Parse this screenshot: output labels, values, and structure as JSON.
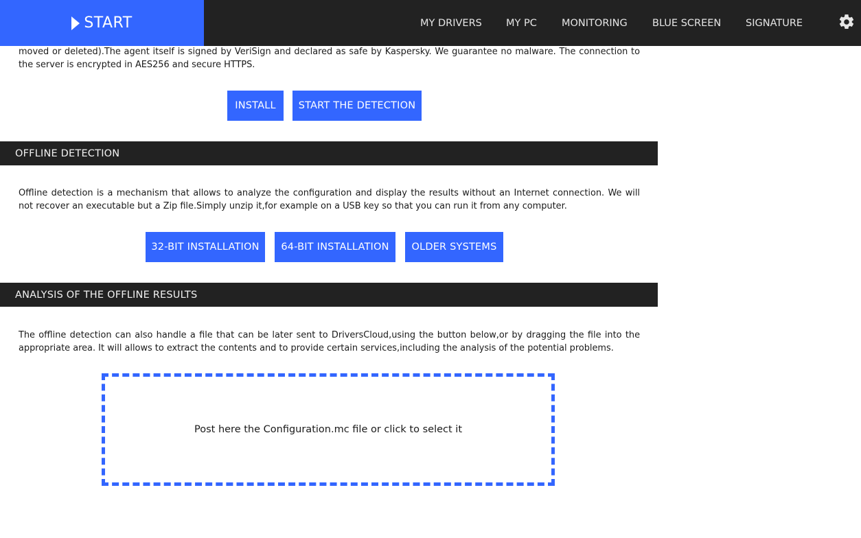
{
  "topbar": {
    "start_label": "START",
    "nav": [
      {
        "label": "MY DRIVERS"
      },
      {
        "label": "MY PC"
      },
      {
        "label": "MONITORING"
      },
      {
        "label": "BLUE SCREEN"
      },
      {
        "label": "SIGNATURE"
      }
    ],
    "settings_icon": "gear-icon"
  },
  "online": {
    "text": "moved or deleted).The agent itself is signed by VeriSign and declared as safe by Kaspersky. We guarantee no malware. The connection to the server is encrypted in AES256 and secure HTTPS.",
    "install_label": "INSTALL",
    "start_detection_label": "START THE DETECTION"
  },
  "offline": {
    "title": "OFFLINE DETECTION",
    "text": "Offline detection is a mechanism that allows to analyze the configuration and display the results without an Internet connection. We will not recover an executable but a Zip file.Simply unzip it,for example on a USB key so that you can run it from any computer.",
    "btn_32": "32-BIT INSTALLATION",
    "btn_64": "64-BIT INSTALLATION",
    "btn_older": "OLDER SYSTEMS"
  },
  "analysis": {
    "title": "ANALYSIS OF THE OFFLINE RESULTS",
    "text": "The offline detection can also handle a file that can be later sent to DriversCloud,using the button below,or by dragging the file into the appropriate area. It will allows to extract the contents and to provide certain services,including the analysis of the potential problems.",
    "dropzone_label": "Post here the Configuration.mc file or click to select it"
  },
  "colors": {
    "accent": "#3366ff",
    "bar": "#222222"
  }
}
